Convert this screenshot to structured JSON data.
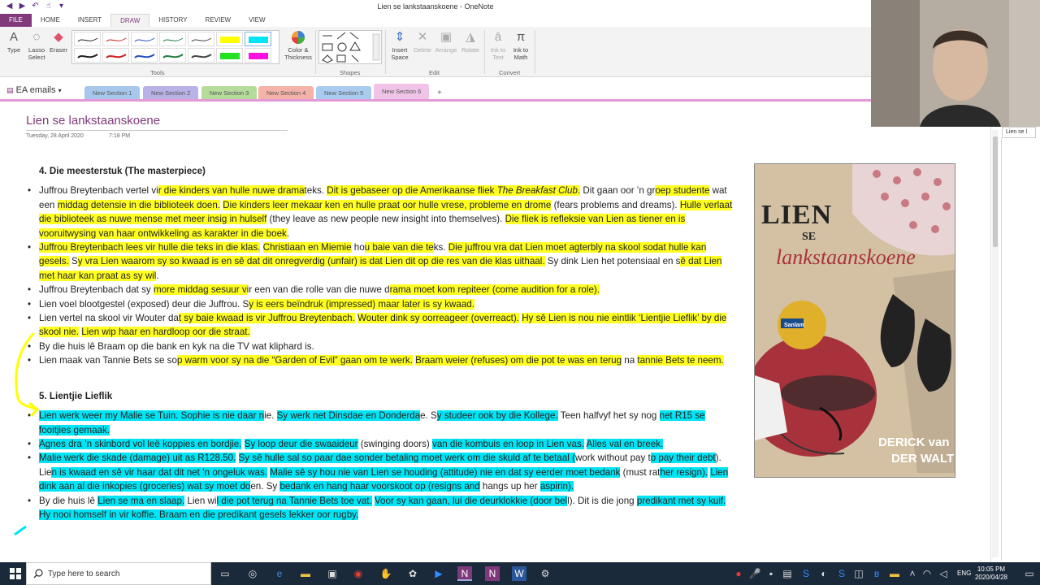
{
  "window": {
    "title": "Lien se lankstaanskoene - OneNote"
  },
  "ribbon_tabs": [
    "FILE",
    "HOME",
    "INSERT",
    "DRAW",
    "HISTORY",
    "REVIEW",
    "VIEW"
  ],
  "ribbon": {
    "type_label": "Type",
    "lasso_label": "Lasso Select",
    "eraser_label": "Eraser",
    "tools_group": "Tools",
    "color_label": "Color & Thickness",
    "shapes_group": "Shapes",
    "insert_space": "Insert Space",
    "delete": "Delete",
    "arrange": "Arrange",
    "rotate": "Rotate",
    "edit_group": "Edit",
    "ink_text": "Ink to Text",
    "ink_math": "Ink to Math",
    "convert_group": "Convert"
  },
  "notebook": {
    "name": "EA emails",
    "sections": [
      {
        "label": "New Section 1",
        "color": "#a7c8ec"
      },
      {
        "label": "New Section 2",
        "color": "#b8b2e6"
      },
      {
        "label": "New Section 3",
        "color": "#b5dc9a"
      },
      {
        "label": "New Section 4",
        "color": "#f4b2a8"
      },
      {
        "label": "New Section 5",
        "color": "#a9cbf0"
      },
      {
        "label": "New Section 6",
        "color": "#f0c4e8"
      }
    ],
    "add_tab": "+"
  },
  "page": {
    "title": "Lien se lankstaanskoene",
    "date": "Tuesday, 28 April 2020",
    "time": "7:18 PM",
    "side_tab": "Lien se l"
  },
  "content": {
    "h4": "4. Die meesterstuk (The masterpiece)",
    "h5": "5. Lientjie Lieflik"
  },
  "cover": {
    "title_line1": "LIEN",
    "title_line2": "SE",
    "title_line3": "lankstaanskoene",
    "author_line1": "DERICK van",
    "author_line2": "DER WALT",
    "badge": "Sanlam"
  },
  "taskbar": {
    "search_placeholder": "Type here to search",
    "lang": "ENG",
    "time": "10:05 PM",
    "date": "2020/04/28"
  }
}
